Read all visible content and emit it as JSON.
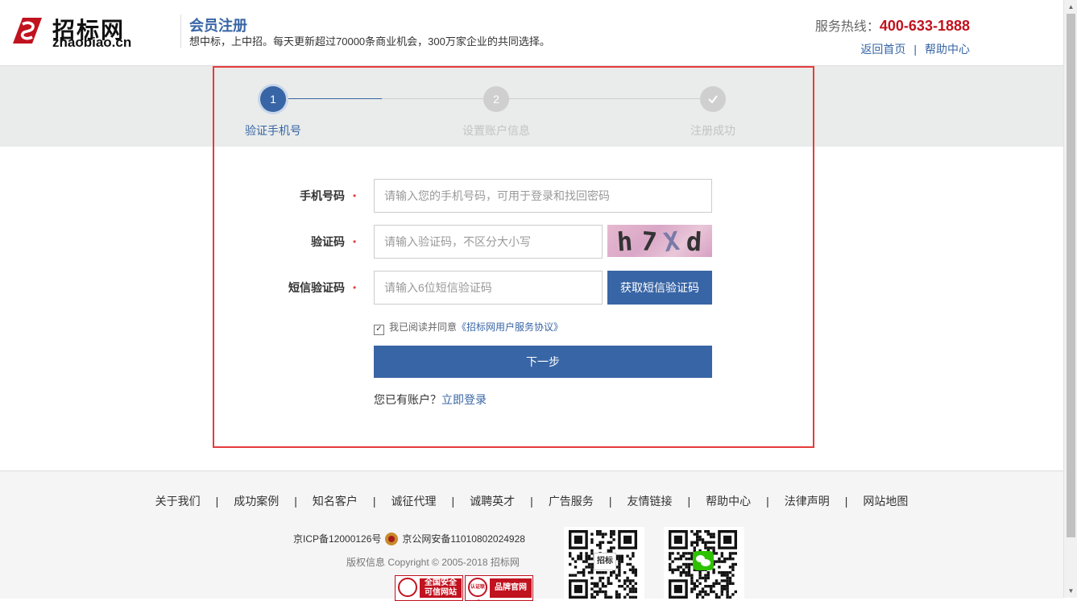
{
  "header": {
    "logo_cn": "招标网",
    "logo_en": "zhaobiao.cn",
    "title": "会员注册",
    "tagline": "想中标，上中招。每天更新超过70000条商业机会，300万家企业的共同选择。",
    "hotline_label": "服务热线：",
    "hotline_number": "400-633-1888",
    "links": [
      "返回首页",
      "帮助中心"
    ]
  },
  "steps": [
    {
      "number": "1",
      "label": "验证手机号",
      "state": "active"
    },
    {
      "number": "2",
      "label": "设置账户信息",
      "state": "pending"
    },
    {
      "number": "check-icon",
      "label": "注册成功",
      "state": "pending"
    }
  ],
  "form": {
    "phone_label": "手机号码",
    "phone_placeholder": "请输入您的手机号码，可用于登录和找回密码",
    "captcha_label": "验证码",
    "captcha_placeholder": "请输入验证码，不区分大小写",
    "captcha_text": "h7Xd",
    "sms_label": "短信验证码",
    "sms_placeholder": "请输入6位短信验证码",
    "sms_button": "获取短信验证码",
    "agree_prefix": "我已阅读并同意",
    "agree_protocol": "《招标网用户服务协议》",
    "agree_checked": true,
    "next_button": "下一步",
    "login_prompt": "您已有账户？",
    "login_link": "立即登录"
  },
  "footer": {
    "links": [
      "关于我们",
      "成功案例",
      "知名客户",
      "诚征代理",
      "诚聘英才",
      "广告服务",
      "友情链接",
      "帮助中心",
      "法律声明",
      "网站地图"
    ],
    "icp": "京ICP备12000126号",
    "police": "京公网安备11010802024928",
    "copyright": "版权信息 Copyright © 2005-2018 招标网",
    "badge1": "全国安全 可信网站",
    "badge2": "品牌官网",
    "badge2_seal": "认证联盟",
    "qr_center_logo": "招标"
  },
  "colors": {
    "brand_blue": "#3865a5",
    "hotline_red": "#c1121f",
    "frame_red": "#e63c3c",
    "band_gray": "#e9ecea"
  }
}
